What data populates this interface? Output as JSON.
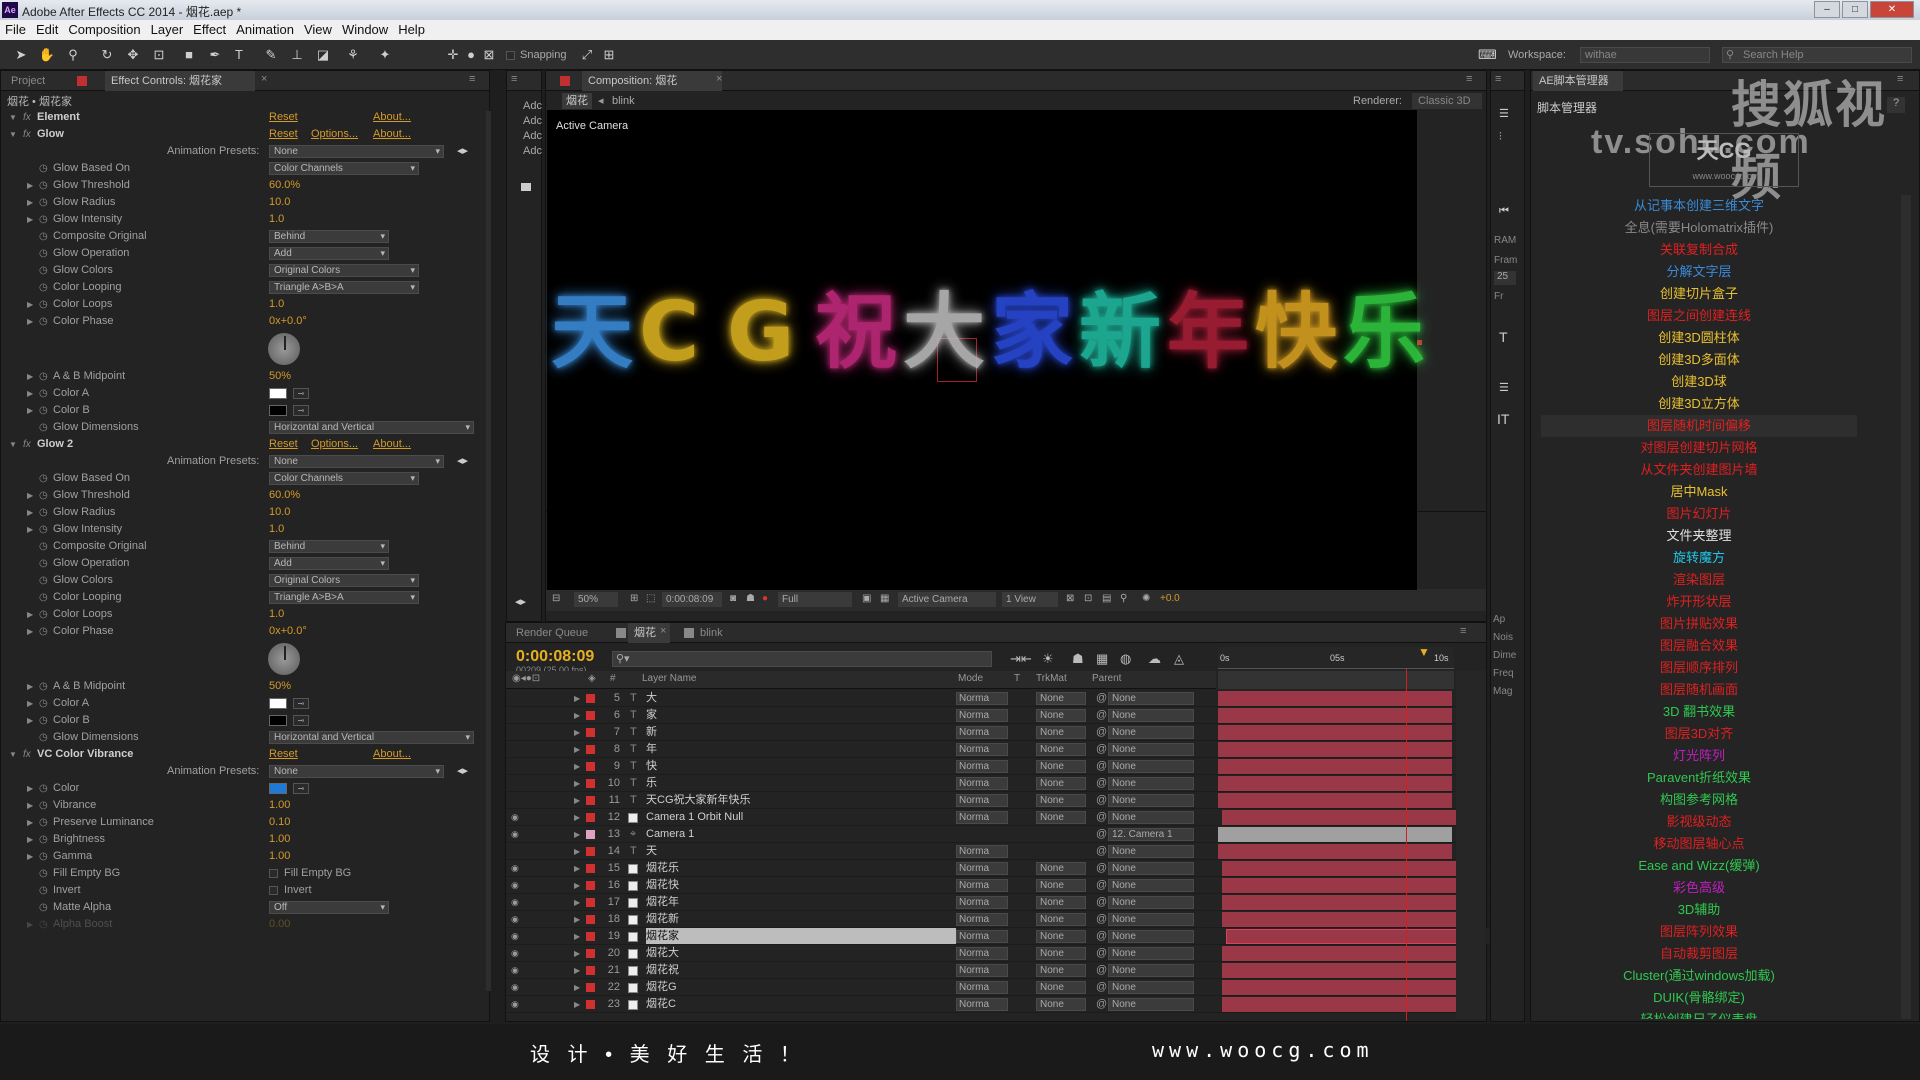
{
  "app": {
    "title": "Adobe After Effects CC 2014 - 烟花.aep *",
    "icon": "Ae"
  },
  "menu": [
    "File",
    "Edit",
    "Composition",
    "Layer",
    "Effect",
    "Animation",
    "View",
    "Window",
    "Help"
  ],
  "toolbar": {
    "snapping": "Snapping",
    "workspace_label": "Workspace:",
    "workspace_value": "withae",
    "search_placeholder": "Search Help"
  },
  "left_panel": {
    "tab_project": "Project",
    "tab_effect_controls": "Effect Controls: 烟花家",
    "breadcrumb": "烟花 • 烟花家",
    "rows": [
      {
        "type": "fx",
        "name": "Element",
        "reset": "Reset",
        "about": "About..."
      },
      {
        "type": "fx",
        "name": "Glow",
        "reset": "Reset",
        "options": "Options...",
        "about": "About..."
      },
      {
        "type": "preset",
        "name": "Animation Presets:",
        "value": "None"
      },
      {
        "type": "dd",
        "name": "Glow Based On",
        "value": "Color Channels"
      },
      {
        "type": "val",
        "name": "Glow Threshold",
        "value": "60.0%"
      },
      {
        "type": "val",
        "name": "Glow Radius",
        "value": "10.0"
      },
      {
        "type": "val",
        "name": "Glow Intensity",
        "value": "1.0"
      },
      {
        "type": "dd",
        "name": "Composite Original",
        "value": "Behind"
      },
      {
        "type": "dd",
        "name": "Glow Operation",
        "value": "Add"
      },
      {
        "type": "dd",
        "name": "Glow Colors",
        "value": "Original Colors"
      },
      {
        "type": "dd",
        "name": "Color Looping",
        "value": "Triangle A>B>A"
      },
      {
        "type": "val",
        "name": "Color Loops",
        "value": "1.0"
      },
      {
        "type": "val",
        "name": "Color Phase",
        "value": "0x+0.0°"
      },
      {
        "type": "dial"
      },
      {
        "type": "val",
        "name": "A & B Midpoint",
        "value": "50%"
      },
      {
        "type": "color",
        "name": "Color A",
        "value": "#ffffff"
      },
      {
        "type": "color",
        "name": "Color B",
        "value": "#000000"
      },
      {
        "type": "dd",
        "name": "Glow Dimensions",
        "value": "Horizontal and Vertical"
      },
      {
        "type": "fx",
        "name": "Glow 2",
        "reset": "Reset",
        "options": "Options...",
        "about": "About..."
      },
      {
        "type": "preset",
        "name": "Animation Presets:",
        "value": "None"
      },
      {
        "type": "dd",
        "name": "Glow Based On",
        "value": "Color Channels"
      },
      {
        "type": "val",
        "name": "Glow Threshold",
        "value": "60.0%"
      },
      {
        "type": "val",
        "name": "Glow Radius",
        "value": "10.0"
      },
      {
        "type": "val",
        "name": "Glow Intensity",
        "value": "1.0"
      },
      {
        "type": "dd",
        "name": "Composite Original",
        "value": "Behind"
      },
      {
        "type": "dd",
        "name": "Glow Operation",
        "value": "Add"
      },
      {
        "type": "dd",
        "name": "Glow Colors",
        "value": "Original Colors"
      },
      {
        "type": "dd",
        "name": "Color Looping",
        "value": "Triangle A>B>A"
      },
      {
        "type": "val",
        "name": "Color Loops",
        "value": "1.0"
      },
      {
        "type": "val",
        "name": "Color Phase",
        "value": "0x+0.0°"
      },
      {
        "type": "dial"
      },
      {
        "type": "val",
        "name": "A & B Midpoint",
        "value": "50%"
      },
      {
        "type": "color",
        "name": "Color A",
        "value": "#ffffff"
      },
      {
        "type": "color",
        "name": "Color B",
        "value": "#000000"
      },
      {
        "type": "dd",
        "name": "Glow Dimensions",
        "value": "Horizontal and Vertical"
      },
      {
        "type": "fx",
        "name": "VC Color Vibrance",
        "reset": "Reset",
        "about": "About..."
      },
      {
        "type": "preset",
        "name": "Animation Presets:",
        "value": "None"
      },
      {
        "type": "color",
        "name": "Color",
        "value": "#1e7ad6"
      },
      {
        "type": "val",
        "name": "Vibrance",
        "value": "1.00"
      },
      {
        "type": "val",
        "name": "Preserve Luminance",
        "value": "0.10"
      },
      {
        "type": "val",
        "name": "Brightness",
        "value": "1.00"
      },
      {
        "type": "val",
        "name": "Gamma",
        "value": "1.00"
      },
      {
        "type": "check",
        "name": "Fill Empty BG",
        "value": "Fill Empty BG"
      },
      {
        "type": "check",
        "name": "Invert",
        "value": "Invert"
      },
      {
        "type": "dd",
        "name": "Matte Alpha",
        "value": "Off"
      },
      {
        "type": "val",
        "name": "Alpha Boost",
        "value": "0.00"
      }
    ]
  },
  "side_mini": [
    "Adc",
    "Adc",
    "Adc",
    "Adc"
  ],
  "comp_panel": {
    "tab": "Composition: 烟花",
    "crumb1": "烟花",
    "crumb2": "blink",
    "renderer_label": "Renderer:",
    "renderer_value": "Classic 3D",
    "camera_label": "Active Camera",
    "glyphs": [
      {
        "t": "天",
        "c": "#3a8bd8"
      },
      {
        "t": "C",
        "c": "#d8b020"
      },
      {
        "t": "G",
        "c": "#d8b020"
      },
      {
        "t": "祝",
        "c": "#c02a7a"
      },
      {
        "t": "大",
        "c": "#b8b8b8"
      },
      {
        "t": "家",
        "c": "#2a4ad8"
      },
      {
        "t": "新",
        "c": "#20b8a0"
      },
      {
        "t": "年",
        "c": "#a82038"
      },
      {
        "t": "快",
        "c": "#d8a020"
      },
      {
        "t": "乐",
        "c": "#30c840"
      }
    ],
    "footer": {
      "zoom": "50%",
      "timecode": "0:00:08:09",
      "res": "Full",
      "camera": "Active Camera",
      "view": "1 View",
      "exposure": "+0.0"
    }
  },
  "timeline": {
    "tab_render": "Render Queue",
    "tab_comp": "烟花",
    "tab_blink": "blink",
    "time": "0:00:08:09",
    "frames": "00209 (25.00 fps)",
    "col_layer": "Layer Name",
    "col_mode": "Mode",
    "col_t": "T",
    "col_trk": "TrkMat",
    "col_parent": "Parent",
    "ruler": [
      "0s",
      "05s",
      "10s"
    ],
    "layers": [
      {
        "n": "5",
        "name": "大",
        "t": "T",
        "mode": "Norma",
        "trk": "None",
        "par": "None",
        "eye": false,
        "sel": false
      },
      {
        "n": "6",
        "name": "家",
        "t": "T",
        "mode": "Norma",
        "trk": "None",
        "par": "None",
        "eye": false,
        "sel": false
      },
      {
        "n": "7",
        "name": "新",
        "t": "T",
        "mode": "Norma",
        "trk": "None",
        "par": "None",
        "eye": false,
        "sel": false
      },
      {
        "n": "8",
        "name": "年",
        "t": "T",
        "mode": "Norma",
        "trk": "None",
        "par": "None",
        "eye": false,
        "sel": false
      },
      {
        "n": "9",
        "name": "快",
        "t": "T",
        "mode": "Norma",
        "trk": "None",
        "par": "None",
        "eye": false,
        "sel": false
      },
      {
        "n": "10",
        "name": "乐",
        "t": "T",
        "mode": "Norma",
        "trk": "None",
        "par": "None",
        "eye": false,
        "sel": false
      },
      {
        "n": "11",
        "name": "天CG祝大家新年快乐",
        "t": "T",
        "mode": "Norma",
        "trk": "None",
        "par": "None",
        "eye": false,
        "sel": false
      },
      {
        "n": "12",
        "name": "Camera 1 Orbit Null",
        "t": "box",
        "mode": "Norma",
        "trk": "None",
        "par": "None",
        "eye": true,
        "sel": false
      },
      {
        "n": "13",
        "name": "Camera 1",
        "t": "cam",
        "mode": "",
        "trk": "",
        "par": "12. Camera 1",
        "eye": true,
        "sel": false
      },
      {
        "n": "14",
        "name": "天",
        "t": "T",
        "mode": "Norma",
        "trk": "",
        "par": "None",
        "eye": false,
        "sel": false
      },
      {
        "n": "15",
        "name": "烟花乐",
        "t": "box",
        "mode": "Norma",
        "trk": "None",
        "par": "None",
        "eye": true,
        "sel": false
      },
      {
        "n": "16",
        "name": "烟花快",
        "t": "box",
        "mode": "Norma",
        "trk": "None",
        "par": "None",
        "eye": true,
        "sel": false
      },
      {
        "n": "17",
        "name": "烟花年",
        "t": "box",
        "mode": "Norma",
        "trk": "None",
        "par": "None",
        "eye": true,
        "sel": false
      },
      {
        "n": "18",
        "name": "烟花新",
        "t": "box",
        "mode": "Norma",
        "trk": "None",
        "par": "None",
        "eye": true,
        "sel": false
      },
      {
        "n": "19",
        "name": "烟花家",
        "t": "box",
        "mode": "Norma",
        "trk": "None",
        "par": "None",
        "eye": true,
        "sel": true
      },
      {
        "n": "20",
        "name": "烟花大",
        "t": "box",
        "mode": "Norma",
        "trk": "None",
        "par": "None",
        "eye": true,
        "sel": false
      },
      {
        "n": "21",
        "name": "烟花祝",
        "t": "box",
        "mode": "Norma",
        "trk": "None",
        "par": "None",
        "eye": true,
        "sel": false
      },
      {
        "n": "22",
        "name": "烟花G",
        "t": "box",
        "mode": "Norma",
        "trk": "None",
        "par": "None",
        "eye": true,
        "sel": false
      },
      {
        "n": "23",
        "name": "烟花C",
        "t": "box",
        "mode": "Norma",
        "trk": "None",
        "par": "None",
        "eye": true,
        "sel": false
      }
    ]
  },
  "mid_strip": {
    "ram": "RAM",
    "fram": "Fram",
    "fram_val": "25",
    "fr": "Fr",
    "labels": [
      "Ap",
      "Nois",
      "Dime",
      "Freq",
      "Mag"
    ]
  },
  "script_panel": {
    "tab": "AE脚本管理器",
    "title": "脚本管理器",
    "watermark": "搜狐视频",
    "watermark_url": "tv.sohu.com",
    "logo_url": "www.woocg.com",
    "items": [
      {
        "t": "从记事本创建三维文字",
        "c": "#3a8bd8"
      },
      {
        "t": "全息(需要Holomatrix插件)",
        "c": "#8a8a8a"
      },
      {
        "t": "关联复制合成",
        "c": "#e02020"
      },
      {
        "t": "分解文字层",
        "c": "#3a8bd8"
      },
      {
        "t": "创建切片盒子",
        "c": "#e8c030"
      },
      {
        "t": "图层之间创建连线",
        "c": "#e02020"
      },
      {
        "t": "创建3D圆柱体",
        "c": "#e8c030"
      },
      {
        "t": "创建3D多面体",
        "c": "#e8c030"
      },
      {
        "t": "创建3D球",
        "c": "#e8c030"
      },
      {
        "t": "创建3D立方体",
        "c": "#e8c030"
      },
      {
        "t": "图层随机时间偏移",
        "c": "#e02020"
      },
      {
        "t": "对图层创建切片网格",
        "c": "#e02020"
      },
      {
        "t": "从文件夹创建图片墙",
        "c": "#e02020"
      },
      {
        "t": "居中Mask",
        "c": "#e8c030"
      },
      {
        "t": "图片幻灯片",
        "c": "#e02020"
      },
      {
        "t": "文件夹整理",
        "c": "#e0e0e0"
      },
      {
        "t": "旋转魔方",
        "c": "#20c8e8"
      },
      {
        "t": "渲染图层",
        "c": "#e02020"
      },
      {
        "t": "炸开形状层",
        "c": "#e02020"
      },
      {
        "t": "图片拼贴效果",
        "c": "#e02020"
      },
      {
        "t": "图层融合效果",
        "c": "#e02020"
      },
      {
        "t": "图层顺序排列",
        "c": "#e02020"
      },
      {
        "t": "图层随机画面",
        "c": "#e02020"
      },
      {
        "t": "3D 翻书效果",
        "c": "#30c850"
      },
      {
        "t": "图层3D对齐",
        "c": "#e02020"
      },
      {
        "t": "灯光阵列",
        "c": "#c020c0"
      },
      {
        "t": "Paravent折纸效果",
        "c": "#30c850"
      },
      {
        "t": "构图参考网格",
        "c": "#30c850"
      },
      {
        "t": "影视级动态",
        "c": "#e02020"
      },
      {
        "t": "移动图层轴心点",
        "c": "#e02020"
      },
      {
        "t": "Ease and Wizz(缓弹)",
        "c": "#30c850"
      },
      {
        "t": "彩色高级",
        "c": "#c020c0"
      },
      {
        "t": "3D辅助",
        "c": "#30c850"
      },
      {
        "t": "图层阵列效果",
        "c": "#e02020"
      },
      {
        "t": "自动裁剪图层",
        "c": "#e02020"
      },
      {
        "t": "Cluster(通过windows加载)",
        "c": "#30c850"
      },
      {
        "t": "DUIK(骨骼绑定)",
        "c": "#30c850"
      },
      {
        "t": "轻松创建尺子仪表盘",
        "c": "#30c850"
      }
    ]
  },
  "footer": {
    "slogan": "设  计  •  美  好  生  活  ！",
    "url": "www.woocg.com"
  }
}
